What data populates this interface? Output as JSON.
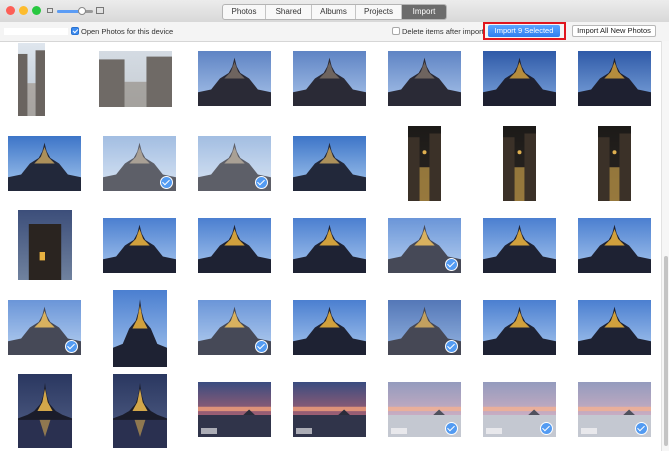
{
  "window": {
    "tabs": [
      {
        "label": "Photos",
        "active": false
      },
      {
        "label": "Shared",
        "active": false
      },
      {
        "label": "Albums",
        "active": false
      },
      {
        "label": "Projects",
        "active": false
      },
      {
        "label": "Import",
        "active": true
      }
    ],
    "zoom_level": 0.7
  },
  "toolbar": {
    "device_name": "",
    "open_photos_label": "Open Photos for this device",
    "open_photos_checked": true,
    "delete_label": "Delete items after import",
    "delete_checked": false,
    "import_selected_label": "Import 9 Selected",
    "import_all_label": "Import All New Photos"
  },
  "colors": {
    "accent": "#2e86f0",
    "highlight": "#e0151d"
  },
  "photos": [
    {
      "scene": "street",
      "selected": false
    },
    {
      "scene": "walls",
      "selected": false
    },
    {
      "scene": "abbey-day",
      "selected": false
    },
    {
      "scene": "abbey-day",
      "selected": false
    },
    {
      "scene": "abbey-day",
      "selected": false
    },
    {
      "scene": "abbey-dusk",
      "selected": false
    },
    {
      "scene": "abbey-dusk",
      "selected": false
    },
    {
      "scene": "abbey-blue",
      "selected": false
    },
    {
      "scene": "abbey-pale",
      "selected": true
    },
    {
      "scene": "abbey-pale",
      "selected": true
    },
    {
      "scene": "abbey-blue",
      "selected": false
    },
    {
      "scene": "night-street",
      "selected": false
    },
    {
      "scene": "night-street",
      "selected": false
    },
    {
      "scene": "night-street",
      "selected": false
    },
    {
      "scene": "night-tower",
      "selected": false
    },
    {
      "scene": "abbey-lit",
      "selected": false
    },
    {
      "scene": "abbey-lit",
      "selected": false
    },
    {
      "scene": "abbey-lit",
      "selected": false
    },
    {
      "scene": "abbey-lit",
      "selected": true
    },
    {
      "scene": "abbey-lit",
      "selected": false
    },
    {
      "scene": "abbey-lit",
      "selected": false
    },
    {
      "scene": "abbey-lit",
      "selected": true
    },
    {
      "scene": "abbey-lit",
      "selected": false
    },
    {
      "scene": "abbey-lit",
      "selected": true
    },
    {
      "scene": "abbey-lit",
      "selected": false
    },
    {
      "scene": "abbey-dusk",
      "selected": true
    },
    {
      "scene": "abbey-lit",
      "selected": false
    },
    {
      "scene": "abbey-lit",
      "selected": false
    },
    {
      "scene": "abbey-reflect",
      "selected": false
    },
    {
      "scene": "abbey-reflect",
      "selected": false
    },
    {
      "scene": "sunset",
      "selected": false
    },
    {
      "scene": "sunset",
      "selected": false
    },
    {
      "scene": "sunset-beach",
      "selected": true
    },
    {
      "scene": "sunset-beach",
      "selected": true
    },
    {
      "scene": "sunset-beach",
      "selected": true
    }
  ]
}
